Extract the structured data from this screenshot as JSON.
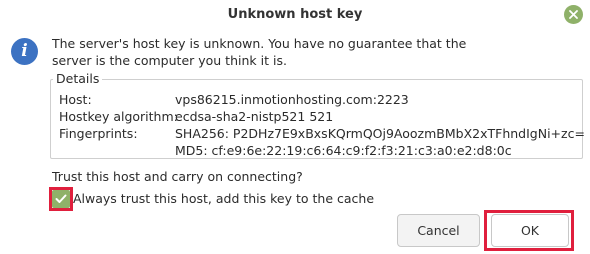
{
  "window": {
    "title": "Unknown host key",
    "close_icon": "close-icon",
    "accent": "#8fb169"
  },
  "message": {
    "icon": "info-icon",
    "text_line1": "The server's host key is unknown. You have no guarantee that the",
    "text_line2": "server is the computer you think it is."
  },
  "details": {
    "legend": "Details",
    "host_label": "Host:",
    "host_value": "vps86215.inmotionhosting.com:2223",
    "algo_label": "Hostkey algorithm:",
    "algo_value": "ecdsa-sha2-nistp521 521",
    "fp_label": "Fingerprints:",
    "fp_sha256": "SHA256: P2DHz7E9xBxsKQrmQOj9AoozmBMbX2xTFhndIgNi+zc=",
    "fp_md5": "MD5: cf:e9:6e:22:19:c6:64:c9:f2:f3:21:c3:a0:e2:d8:0c"
  },
  "prompt": {
    "question": "Trust this host and carry on connecting?",
    "checkbox_label": "Always trust this host, add this key to the cache",
    "checkbox_checked": true,
    "highlight_color": "#e01f3d"
  },
  "buttons": {
    "cancel": "Cancel",
    "ok": "OK"
  }
}
